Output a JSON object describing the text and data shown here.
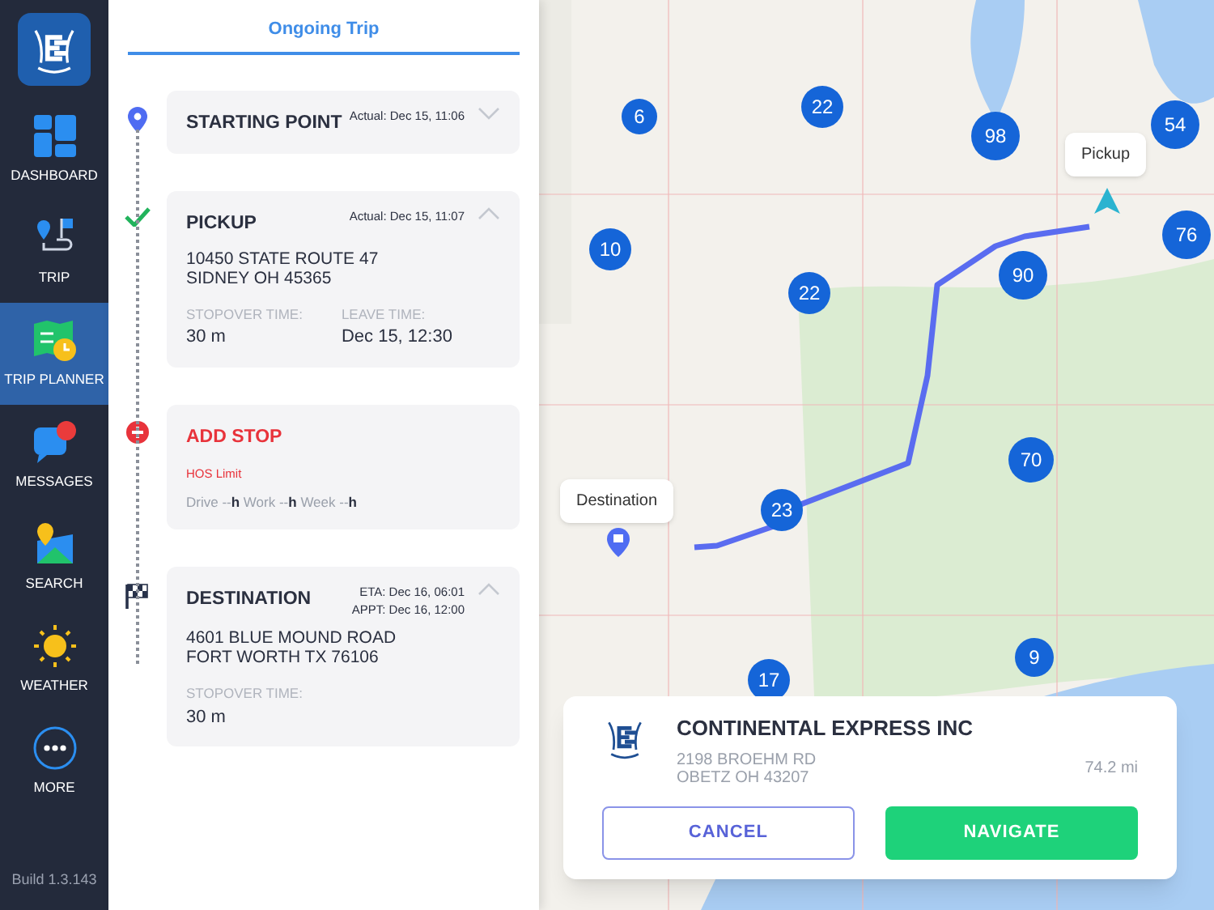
{
  "sidebar": {
    "items": [
      {
        "label": "DASHBOARD",
        "kind": "dashboard",
        "selected": false
      },
      {
        "label": "TRIP",
        "kind": "trip",
        "selected": false
      },
      {
        "label": "TRIP PLANNER",
        "kind": "planner",
        "selected": true
      },
      {
        "label": "MESSAGES",
        "kind": "messages",
        "selected": false
      },
      {
        "label": "SEARCH",
        "kind": "search",
        "selected": false
      },
      {
        "label": "WEATHER",
        "kind": "weather",
        "selected": false
      },
      {
        "label": "MORE",
        "kind": "more",
        "selected": false
      }
    ],
    "build": "Build 1.3.143"
  },
  "panel": {
    "tab": "Ongoing Trip",
    "stops": [
      {
        "kind": "start",
        "title": "STARTING POINT",
        "times": [
          "Actual: Dec 15, 11:06"
        ],
        "expanded": false
      },
      {
        "kind": "pickup",
        "title": "PICKUP",
        "times": [
          "Actual: Dec 15, 11:07"
        ],
        "expanded": true,
        "address": [
          "10450 STATE ROUTE 47",
          "SIDNEY OH 45365"
        ],
        "fields": [
          {
            "label": "STOPOVER TIME:",
            "value": "30 m"
          },
          {
            "label": "LEAVE TIME:",
            "value": "Dec 15, 12:30"
          }
        ]
      },
      {
        "kind": "add",
        "title": "ADD STOP",
        "hos_label": "HOS Limit",
        "hos": "Drive --**h** Work --**h** Week --**h**"
      },
      {
        "kind": "destination",
        "title": "DESTINATION",
        "times": [
          "ETA: Dec 16, 06:01",
          "APPT: Dec 16, 12:00"
        ],
        "expanded": true,
        "address": [
          "4601 BLUE MOUND ROAD",
          "FORT WORTH TX 76106"
        ],
        "fields": [
          {
            "label": "STOPOVER TIME:",
            "value": "30 m"
          }
        ]
      }
    ]
  },
  "map": {
    "clusters": [
      "6",
      "22",
      "98",
      "54",
      "76",
      "90",
      "10",
      "22",
      "70",
      "23",
      "17",
      "9"
    ],
    "callouts": [
      {
        "kind": "pickup",
        "label": "Pickup"
      },
      {
        "kind": "destination",
        "label": "Destination"
      }
    ],
    "card": {
      "name": "CONTINENTAL EXPRESS INC",
      "address": [
        "2198 BROEHM RD",
        "OBETZ OH 43207"
      ],
      "distance": "74.2 mi",
      "buttons": [
        {
          "kind": "secondary",
          "label": "CANCEL"
        },
        {
          "kind": "primary",
          "label": "NAVIGATE"
        }
      ]
    }
  }
}
